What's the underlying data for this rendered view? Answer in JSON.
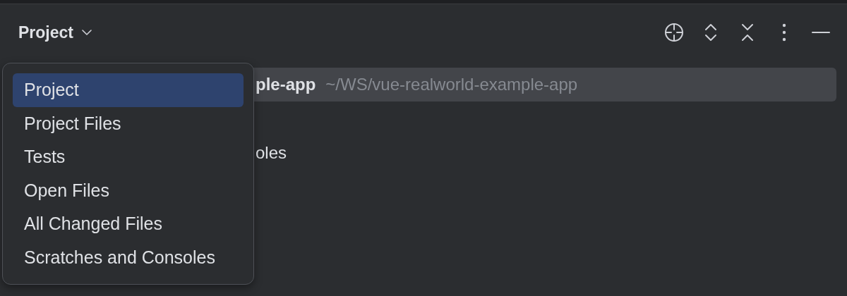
{
  "header": {
    "title": "Project"
  },
  "tree": {
    "rows": [
      {
        "name": "ple-app",
        "path": "~/WS/vue-realworld-example-app",
        "selected": true
      },
      {
        "name": "oles",
        "selected": false
      }
    ]
  },
  "popup": {
    "items": [
      {
        "label": "Project",
        "selected": true
      },
      {
        "label": "Project Files",
        "selected": false
      },
      {
        "label": "Tests",
        "selected": false
      },
      {
        "label": "Open Files",
        "selected": false
      },
      {
        "label": "All Changed Files",
        "selected": false
      },
      {
        "label": "Scratches and Consoles",
        "selected": false
      }
    ]
  }
}
